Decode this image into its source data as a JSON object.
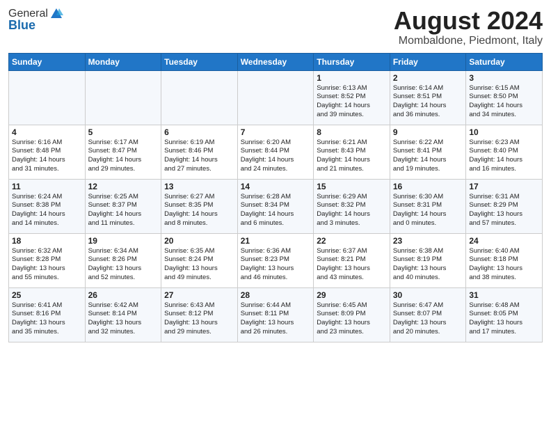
{
  "logo": {
    "general": "General",
    "blue": "Blue"
  },
  "title": "August 2024",
  "subtitle": "Mombaldone, Piedmont, Italy",
  "days_of_week": [
    "Sunday",
    "Monday",
    "Tuesday",
    "Wednesday",
    "Thursday",
    "Friday",
    "Saturday"
  ],
  "weeks": [
    [
      {
        "day": "",
        "info": ""
      },
      {
        "day": "",
        "info": ""
      },
      {
        "day": "",
        "info": ""
      },
      {
        "day": "",
        "info": ""
      },
      {
        "day": "1",
        "info": "Sunrise: 6:13 AM\nSunset: 8:52 PM\nDaylight: 14 hours\nand 39 minutes."
      },
      {
        "day": "2",
        "info": "Sunrise: 6:14 AM\nSunset: 8:51 PM\nDaylight: 14 hours\nand 36 minutes."
      },
      {
        "day": "3",
        "info": "Sunrise: 6:15 AM\nSunset: 8:50 PM\nDaylight: 14 hours\nand 34 minutes."
      }
    ],
    [
      {
        "day": "4",
        "info": "Sunrise: 6:16 AM\nSunset: 8:48 PM\nDaylight: 14 hours\nand 31 minutes."
      },
      {
        "day": "5",
        "info": "Sunrise: 6:17 AM\nSunset: 8:47 PM\nDaylight: 14 hours\nand 29 minutes."
      },
      {
        "day": "6",
        "info": "Sunrise: 6:19 AM\nSunset: 8:46 PM\nDaylight: 14 hours\nand 27 minutes."
      },
      {
        "day": "7",
        "info": "Sunrise: 6:20 AM\nSunset: 8:44 PM\nDaylight: 14 hours\nand 24 minutes."
      },
      {
        "day": "8",
        "info": "Sunrise: 6:21 AM\nSunset: 8:43 PM\nDaylight: 14 hours\nand 21 minutes."
      },
      {
        "day": "9",
        "info": "Sunrise: 6:22 AM\nSunset: 8:41 PM\nDaylight: 14 hours\nand 19 minutes."
      },
      {
        "day": "10",
        "info": "Sunrise: 6:23 AM\nSunset: 8:40 PM\nDaylight: 14 hours\nand 16 minutes."
      }
    ],
    [
      {
        "day": "11",
        "info": "Sunrise: 6:24 AM\nSunset: 8:38 PM\nDaylight: 14 hours\nand 14 minutes."
      },
      {
        "day": "12",
        "info": "Sunrise: 6:25 AM\nSunset: 8:37 PM\nDaylight: 14 hours\nand 11 minutes."
      },
      {
        "day": "13",
        "info": "Sunrise: 6:27 AM\nSunset: 8:35 PM\nDaylight: 14 hours\nand 8 minutes."
      },
      {
        "day": "14",
        "info": "Sunrise: 6:28 AM\nSunset: 8:34 PM\nDaylight: 14 hours\nand 6 minutes."
      },
      {
        "day": "15",
        "info": "Sunrise: 6:29 AM\nSunset: 8:32 PM\nDaylight: 14 hours\nand 3 minutes."
      },
      {
        "day": "16",
        "info": "Sunrise: 6:30 AM\nSunset: 8:31 PM\nDaylight: 14 hours\nand 0 minutes."
      },
      {
        "day": "17",
        "info": "Sunrise: 6:31 AM\nSunset: 8:29 PM\nDaylight: 13 hours\nand 57 minutes."
      }
    ],
    [
      {
        "day": "18",
        "info": "Sunrise: 6:32 AM\nSunset: 8:28 PM\nDaylight: 13 hours\nand 55 minutes."
      },
      {
        "day": "19",
        "info": "Sunrise: 6:34 AM\nSunset: 8:26 PM\nDaylight: 13 hours\nand 52 minutes."
      },
      {
        "day": "20",
        "info": "Sunrise: 6:35 AM\nSunset: 8:24 PM\nDaylight: 13 hours\nand 49 minutes."
      },
      {
        "day": "21",
        "info": "Sunrise: 6:36 AM\nSunset: 8:23 PM\nDaylight: 13 hours\nand 46 minutes."
      },
      {
        "day": "22",
        "info": "Sunrise: 6:37 AM\nSunset: 8:21 PM\nDaylight: 13 hours\nand 43 minutes."
      },
      {
        "day": "23",
        "info": "Sunrise: 6:38 AM\nSunset: 8:19 PM\nDaylight: 13 hours\nand 40 minutes."
      },
      {
        "day": "24",
        "info": "Sunrise: 6:40 AM\nSunset: 8:18 PM\nDaylight: 13 hours\nand 38 minutes."
      }
    ],
    [
      {
        "day": "25",
        "info": "Sunrise: 6:41 AM\nSunset: 8:16 PM\nDaylight: 13 hours\nand 35 minutes."
      },
      {
        "day": "26",
        "info": "Sunrise: 6:42 AM\nSunset: 8:14 PM\nDaylight: 13 hours\nand 32 minutes."
      },
      {
        "day": "27",
        "info": "Sunrise: 6:43 AM\nSunset: 8:12 PM\nDaylight: 13 hours\nand 29 minutes."
      },
      {
        "day": "28",
        "info": "Sunrise: 6:44 AM\nSunset: 8:11 PM\nDaylight: 13 hours\nand 26 minutes."
      },
      {
        "day": "29",
        "info": "Sunrise: 6:45 AM\nSunset: 8:09 PM\nDaylight: 13 hours\nand 23 minutes."
      },
      {
        "day": "30",
        "info": "Sunrise: 6:47 AM\nSunset: 8:07 PM\nDaylight: 13 hours\nand 20 minutes."
      },
      {
        "day": "31",
        "info": "Sunrise: 6:48 AM\nSunset: 8:05 PM\nDaylight: 13 hours\nand 17 minutes."
      }
    ]
  ]
}
